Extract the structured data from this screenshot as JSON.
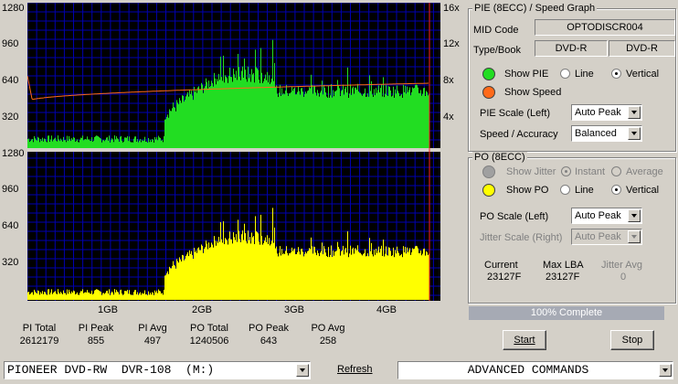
{
  "graph": {
    "upper_y_labels": [
      "1280",
      "960",
      "640",
      "320"
    ],
    "upper_speed_labels": [
      "16x",
      "12x",
      "8x",
      "4x"
    ],
    "lower_y_labels": [
      "1280",
      "960",
      "640",
      "320"
    ],
    "x_labels": [
      "1GB",
      "2GB",
      "3GB",
      "4GB"
    ]
  },
  "stats": [
    {
      "label": "PI Total",
      "value": "2612179"
    },
    {
      "label": "PI Peak",
      "value": "855"
    },
    {
      "label": "PI Avg",
      "value": "497"
    },
    {
      "label": "PO Total",
      "value": "1240506"
    },
    {
      "label": "PO Peak",
      "value": "643"
    },
    {
      "label": "PO Avg",
      "value": "258"
    }
  ],
  "pie_panel": {
    "title": "PIE (8ECC) / Speed Graph",
    "mid_label": "MID Code",
    "mid_value": "OPTODISCR004",
    "type_label": "Type/Book",
    "type_value": "DVD-R",
    "book_value": "DVD-R",
    "show_pie": "Show PIE",
    "show_speed": "Show Speed",
    "line": "Line",
    "vertical": "Vertical",
    "scale_label": "PIE Scale (Left)",
    "scale_value": "Auto Peak",
    "speed_label": "Speed / Accuracy",
    "speed_value": "Balanced",
    "pie_color": "#22dd22",
    "speed_color": "#ff6a1a"
  },
  "po_panel": {
    "title": "PO (8ECC)",
    "show_jitter": "Show Jitter",
    "instant": "Instant",
    "average": "Average",
    "show_po": "Show PO",
    "line": "Line",
    "vertical": "Vertical",
    "scale_label": "PO Scale (Left)",
    "scale_value": "Auto Peak",
    "jitter_label": "Jitter Scale (Right)",
    "jitter_value": "Auto Peak",
    "current_label": "Current",
    "current_value": "23127F",
    "maxlba_label": "Max LBA",
    "maxlba_value": "23127F",
    "jitteravg_label": "Jitter Avg",
    "jitteravg_value": "0",
    "po_color": "#ffff00"
  },
  "progress": {
    "text": "100% Complete",
    "fraction": 1.0
  },
  "buttons": {
    "start": "Start",
    "stop": "Stop",
    "refresh": "Refresh"
  },
  "drive": {
    "value": "PIONEER DVD-RW  DVR-108  (M:)"
  },
  "commands": {
    "value": "ADVANCED COMMANDS"
  }
}
